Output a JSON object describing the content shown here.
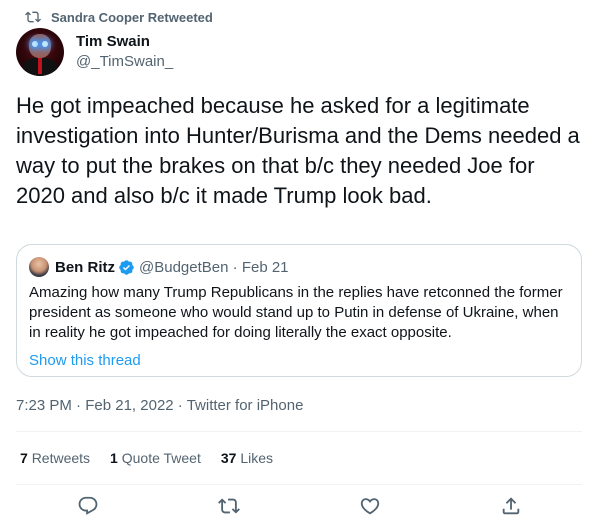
{
  "retweet_header": {
    "text": "Sandra Cooper Retweeted",
    "icon": "retweet-icon"
  },
  "author": {
    "display_name": "Tim Swain",
    "handle": "@_TimSwain_"
  },
  "tweet": {
    "text": "He got impeached because he asked for a legitimate investigation into Hunter/Burisma and the Dems needed a way to put the brakes on that b/c they needed Joe for 2020 and also b/c it made Trump look bad."
  },
  "quoted_tweet": {
    "display_name": "Ben Ritz",
    "handle": "@BudgetBen",
    "separator": "·",
    "date": "Feb 21",
    "text": "Amazing how many Trump Republicans in the replies have retconned the former president as someone who would stand up to Putin in defense of Ukraine, when in reality he got impeached for doing literally the exact opposite.",
    "show_thread": "Show this thread"
  },
  "meta": {
    "time": "7:23 PM",
    "separator": "·",
    "date": "Feb 21, 2022",
    "app": "Twitter for iPhone"
  },
  "stats": {
    "retweets_count": "7",
    "retweets_label": "Retweets",
    "quotes_count": "1",
    "quotes_label": "Quote Tweet",
    "likes_count": "37",
    "likes_label": "Likes"
  },
  "actions": [
    "reply-icon",
    "retweet-icon",
    "like-icon",
    "share-icon"
  ],
  "colors": {
    "text_primary": "#0f1419",
    "text_secondary": "#536471",
    "accent": "#1d9bf0",
    "border": "#cfd9de"
  }
}
